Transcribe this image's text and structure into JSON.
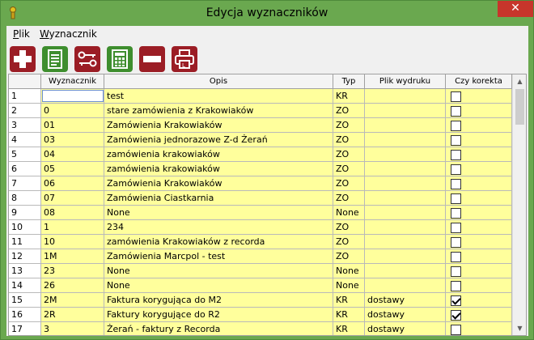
{
  "window": {
    "title": "Edycja wyznaczników",
    "close_glyph": "✕"
  },
  "menu": [
    {
      "label": "Plik",
      "accel": "P",
      "rest": "lik"
    },
    {
      "label": "Wyznacznik",
      "accel": "W",
      "rest": "yznacznik"
    }
  ],
  "toolbar": [
    {
      "name": "add-icon",
      "color": "#9b1d25"
    },
    {
      "name": "edit-document-icon",
      "color": "#3e8e2e"
    },
    {
      "name": "key-link-icon",
      "color": "#9b1d25"
    },
    {
      "name": "calculator-icon",
      "color": "#3e8e2e"
    },
    {
      "name": "remove-icon",
      "color": "#9b1d25"
    },
    {
      "name": "print-icon",
      "color": "#9b1d25"
    }
  ],
  "columns": [
    "",
    "Wyznacznik",
    "Opis",
    "Typ",
    "Plik wydruku",
    "Czy korekta"
  ],
  "rows": [
    {
      "idx": "1",
      "code": "",
      "desc": "test",
      "type": "KR",
      "file": "",
      "corr": false
    },
    {
      "idx": "2",
      "code": "0",
      "desc": "stare zamówienia z Krakowiaków",
      "type": "ZO",
      "file": "",
      "corr": false
    },
    {
      "idx": "3",
      "code": "01",
      "desc": "Zamówienia Krakowiaków",
      "type": "ZO",
      "file": "",
      "corr": false
    },
    {
      "idx": "4",
      "code": "03",
      "desc": "Zamówienia jednorazowe Z-d Żerań",
      "type": "ZO",
      "file": "",
      "corr": false
    },
    {
      "idx": "5",
      "code": "04",
      "desc": "zamówienia krakowiaków",
      "type": "ZO",
      "file": "",
      "corr": false
    },
    {
      "idx": "6",
      "code": "05",
      "desc": "zamówienia krakowiaków",
      "type": "ZO",
      "file": "",
      "corr": false
    },
    {
      "idx": "7",
      "code": "06",
      "desc": "Zamówienia Krakowiaków",
      "type": "ZO",
      "file": "",
      "corr": false
    },
    {
      "idx": "8",
      "code": "07",
      "desc": "Zamówienia Ciastkarnia",
      "type": "ZO",
      "file": "",
      "corr": false
    },
    {
      "idx": "9",
      "code": "08",
      "desc": "None",
      "type": "None",
      "file": "",
      "corr": false
    },
    {
      "idx": "10",
      "code": "1",
      "desc": "234",
      "type": "ZO",
      "file": "",
      "corr": false
    },
    {
      "idx": "11",
      "code": "10",
      "desc": "zamówienia Krakowiaków z recorda",
      "type": "ZO",
      "file": "",
      "corr": false
    },
    {
      "idx": "12",
      "code": "1M",
      "desc": "Zamówienia Marcpol - test",
      "type": "ZO",
      "file": "",
      "corr": false
    },
    {
      "idx": "13",
      "code": "23",
      "desc": "None",
      "type": "None",
      "file": "",
      "corr": false
    },
    {
      "idx": "14",
      "code": "26",
      "desc": "None",
      "type": "None",
      "file": "",
      "corr": false
    },
    {
      "idx": "15",
      "code": "2M",
      "desc": "Faktura korygująca do M2",
      "type": "KR",
      "file": "dostawy",
      "corr": true
    },
    {
      "idx": "16",
      "code": "2R",
      "desc": "Faktury korygujące do R2",
      "type": "KR",
      "file": "dostawy",
      "corr": true
    },
    {
      "idx": "17",
      "code": "3",
      "desc": "Żerań - faktury z Recorda",
      "type": "KR",
      "file": "dostawy",
      "corr": false
    }
  ]
}
